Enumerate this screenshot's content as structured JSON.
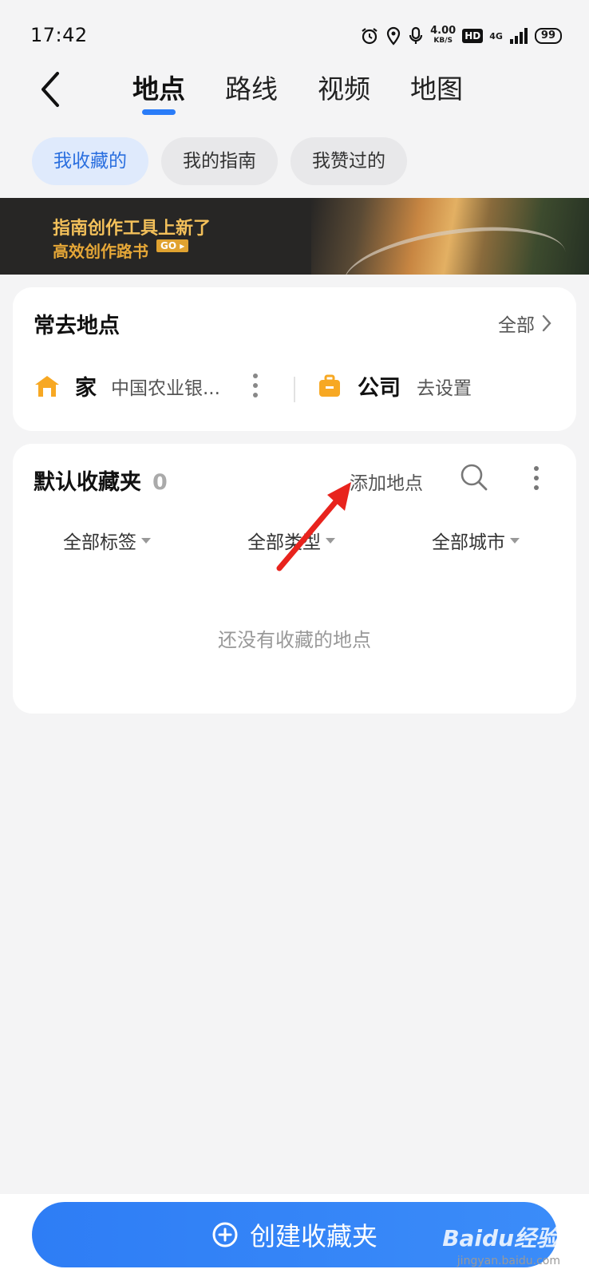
{
  "status_bar": {
    "time": "17:42",
    "speed_value": "4.00",
    "speed_unit": "KB/S",
    "hd": "HD",
    "network": "4G",
    "battery": "99"
  },
  "header": {
    "tabs": [
      {
        "label": "地点",
        "active": true
      },
      {
        "label": "路线",
        "active": false
      },
      {
        "label": "视频",
        "active": false
      },
      {
        "label": "地图",
        "active": false
      }
    ]
  },
  "chips": [
    {
      "label": "我收藏的",
      "active": true
    },
    {
      "label": "我的指南",
      "active": false
    },
    {
      "label": "我赞过的",
      "active": false
    }
  ],
  "banner": {
    "title": "指南创作工具上新了",
    "subtitle": "高效创作路书",
    "go": "GO"
  },
  "frequent": {
    "title": "常去地点",
    "all_label": "全部",
    "home_label": "家",
    "home_address": "中国农业银...",
    "company_label": "公司",
    "company_action": "去设置"
  },
  "folder": {
    "title": "默认收藏夹",
    "count": "0",
    "add_place": "添加地点",
    "filters": [
      "全部标签",
      "全部类型",
      "全部城市"
    ],
    "empty_text": "还没有收藏的地点"
  },
  "bottom": {
    "create_label": "创建收藏夹",
    "watermark": "Baidu经验",
    "watermark_url": "jingyan.baidu.com"
  },
  "colors": {
    "accent": "#2a7cf8",
    "icon_orange": "#f7a823",
    "annotation_red": "#e8231d"
  }
}
